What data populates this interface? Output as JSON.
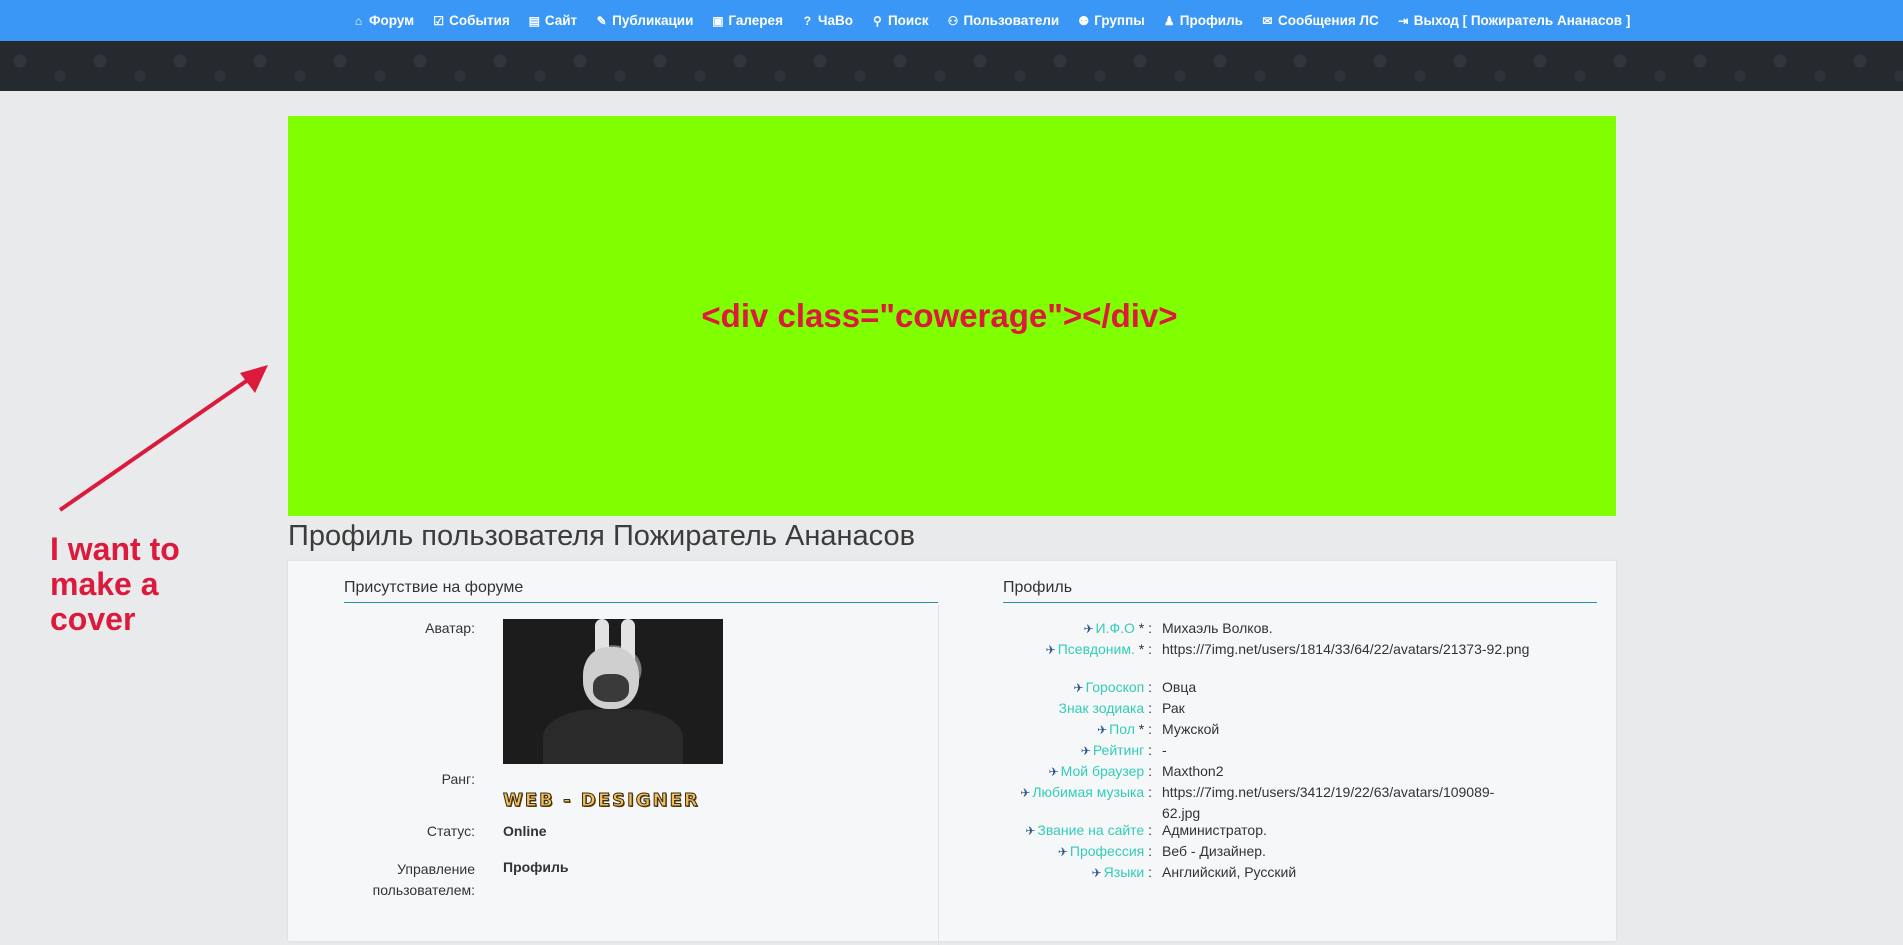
{
  "nav": [
    {
      "icon": "home-icon",
      "glyph": "⌂",
      "label": "Форум"
    },
    {
      "icon": "calendar-icon",
      "glyph": "☑",
      "label": "События"
    },
    {
      "icon": "document-icon",
      "glyph": "▤",
      "label": "Сайт"
    },
    {
      "icon": "pencil-icon",
      "glyph": "✎",
      "label": "Публикации"
    },
    {
      "icon": "image-icon",
      "glyph": "▣",
      "label": "Галерея"
    },
    {
      "icon": "question-icon",
      "glyph": "?",
      "label": "ЧаВо"
    },
    {
      "icon": "search-icon",
      "glyph": "⚲",
      "label": "Поиск"
    },
    {
      "icon": "users-icon",
      "glyph": "⚇",
      "label": "Пользователи"
    },
    {
      "icon": "group-icon",
      "glyph": "⚉",
      "label": "Группы"
    },
    {
      "icon": "user-icon",
      "glyph": "♟",
      "label": "Профиль"
    },
    {
      "icon": "mail-icon",
      "glyph": "✉",
      "label": "Сообщения ЛС"
    },
    {
      "icon": "logout-icon",
      "glyph": "⇥",
      "label": "Выход [ Пожиратель Ананасов ]"
    }
  ],
  "cover": {
    "text": "<div class=\"cowerage\"></div>",
    "background": "#80ff00",
    "text_color": "#dc1a3c"
  },
  "annotation": {
    "line1": "I want to",
    "line2": "make a",
    "line3": "cover",
    "color": "#dc1a3c"
  },
  "page_title": "Профиль пользователя Пожиратель Ананасов",
  "presence": {
    "title": "Присутствие на форуме",
    "avatar_label": "Аватар:",
    "rank_label": "Ранг:",
    "rank_value": "WEB - DESIGNER",
    "status_label": "Статус:",
    "status_value": "Online",
    "manage_label_1": "Управление",
    "manage_label_2": "пользователем:",
    "manage_value": "Профиль"
  },
  "profile": {
    "title": "Профиль",
    "fields": [
      {
        "icon": true,
        "name": "И.Ф.О",
        "req": " * :",
        "value": "Михаэль Волков."
      },
      {
        "icon": true,
        "name": "Псевдоним.",
        "req": " * :",
        "value": "https://7img.net/users/1814/33/64/22/avatars/21373-92.png"
      },
      {
        "icon": true,
        "name": "Гороскоп",
        "req": " :",
        "value": "Овца"
      },
      {
        "icon": false,
        "name": "Знак зодиака",
        "req": " :",
        "value": "Рак"
      },
      {
        "icon": true,
        "name": "Пол",
        "req": " * :",
        "value": "Мужской"
      },
      {
        "icon": true,
        "name": "Рейтинг",
        "req": " :",
        "value": " -"
      },
      {
        "icon": true,
        "name": "Мой браузер",
        "req": " :",
        "value": "Maxthon2"
      },
      {
        "icon": true,
        "name": "Любимая музыка",
        "req": " :",
        "value": "https://7img.net/users/3412/19/22/63/avatars/109089-62.jpg"
      },
      {
        "icon": true,
        "name": "Звание на сайте",
        "req": " :",
        "value": "Администратор."
      },
      {
        "icon": true,
        "name": "Профессия",
        "req": " :",
        "value": "Веб - Дизайнер."
      },
      {
        "icon": true,
        "name": "Языки",
        "req": " :",
        "value": "Английский, Русский"
      }
    ]
  },
  "colors": {
    "nav_bg": "#3a97f5",
    "page_bg": "#e9eaec",
    "field_name": "#33ccb8",
    "section_rule": "#2c8f9e"
  }
}
